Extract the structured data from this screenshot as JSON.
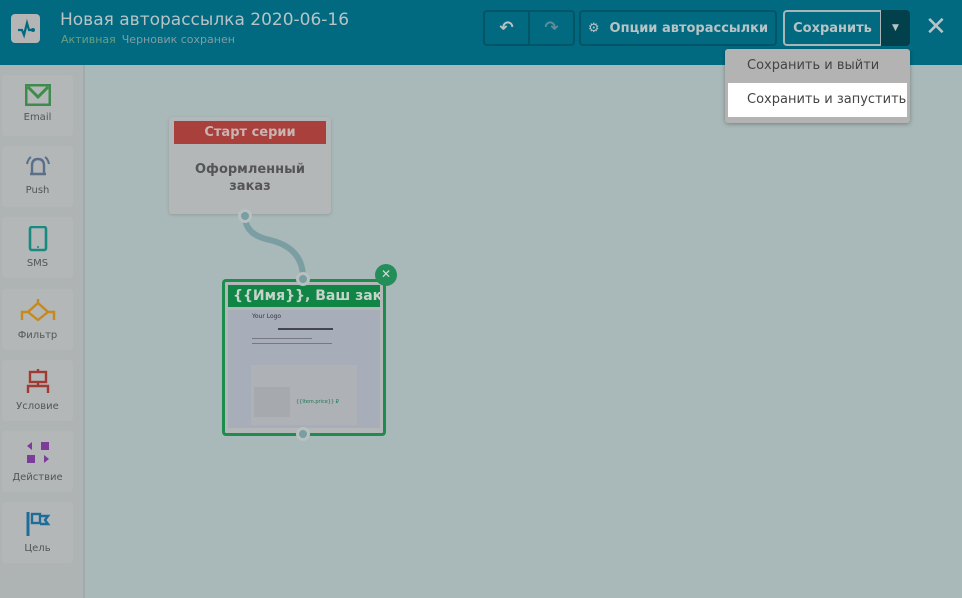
{
  "header": {
    "title": "Новая авторассылка 2020-06-16",
    "status": "Активная",
    "draft": "Черновик сохранен",
    "undo": "↶",
    "redo": "↷",
    "options_label": "Опции авторассылки",
    "save_label": "Сохранить",
    "caret": "▼",
    "close": "✕"
  },
  "save_menu": {
    "items": [
      "Сохранить и выйти",
      "Сохранить и запустить"
    ]
  },
  "sidebar": {
    "items": [
      "Email",
      "Push",
      "SMS",
      "Фильтр",
      "Условие",
      "Действие",
      "Цель"
    ]
  },
  "canvas": {
    "start_node": {
      "header": "Старт серии",
      "body": "Оформленный заказ"
    },
    "email_node": {
      "header": "{{Имя}}, Ваш заказ б...",
      "thumb_logo": "Your Logo",
      "thumb_price": "{{Item.price}} ₽",
      "delete": "✕"
    }
  },
  "colors": {
    "header": "#016a80",
    "start": "#a9403c",
    "email": "#118545"
  }
}
